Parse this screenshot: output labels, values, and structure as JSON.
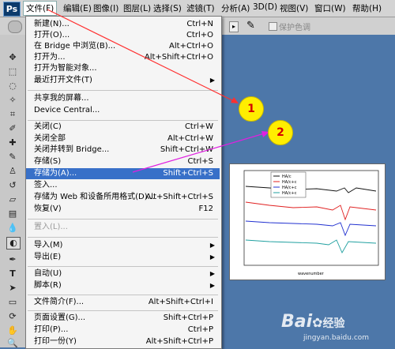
{
  "app_logo": "Ps",
  "menubar": [
    "文件(F)",
    "编辑(E)",
    "图像(I)",
    "图层(L)",
    "选择(S)",
    "滤镜(T)",
    "分析(A)",
    "3D(D)",
    "视图(V)",
    "窗口(W)",
    "帮助(H)"
  ],
  "options": {
    "protect_color": "保护色调"
  },
  "file_menu": [
    {
      "label": "新建(N)...",
      "shortcut": "Ctrl+N"
    },
    {
      "label": "打开(O)...",
      "shortcut": "Ctrl+O"
    },
    {
      "label": "在 Bridge 中浏览(B)...",
      "shortcut": "Alt+Ctrl+O"
    },
    {
      "label": "打开为...",
      "shortcut": "Alt+Shift+Ctrl+O"
    },
    {
      "label": "打开为智能对象...",
      "shortcut": ""
    },
    {
      "label": "最近打开文件(T)",
      "shortcut": ""
    },
    {
      "label": "共享我的屏幕...",
      "shortcut": ""
    },
    {
      "label": "Device Central...",
      "shortcut": ""
    },
    {
      "label": "关闭(C)",
      "shortcut": "Ctrl+W"
    },
    {
      "label": "关闭全部",
      "shortcut": "Alt+Ctrl+W"
    },
    {
      "label": "关闭并转到 Bridge...",
      "shortcut": "Shift+Ctrl+W"
    },
    {
      "label": "存储(S)",
      "shortcut": "Ctrl+S"
    },
    {
      "label": "存储为(A)...",
      "shortcut": "Shift+Ctrl+S"
    },
    {
      "label": "签入...",
      "shortcut": ""
    },
    {
      "label": "存储为 Web 和设备所用格式(D)...",
      "shortcut": "Alt+Shift+Ctrl+S"
    },
    {
      "label": "恢复(V)",
      "shortcut": "F12"
    },
    {
      "label": "置入(L)...",
      "shortcut": ""
    },
    {
      "label": "导入(M)",
      "shortcut": ""
    },
    {
      "label": "导出(E)",
      "shortcut": ""
    },
    {
      "label": "自动(U)",
      "shortcut": ""
    },
    {
      "label": "脚本(R)",
      "shortcut": ""
    },
    {
      "label": "文件简介(F)...",
      "shortcut": "Alt+Shift+Ctrl+I"
    },
    {
      "label": "页面设置(G)...",
      "shortcut": "Shift+Ctrl+P"
    },
    {
      "label": "打印(P)...",
      "shortcut": "Ctrl+P"
    },
    {
      "label": "打印一份(Y)",
      "shortcut": "Alt+Shift+Ctrl+P"
    }
  ],
  "callouts": [
    "1",
    "2"
  ],
  "doc_legend": [
    "HA/c",
    "HA/c+c",
    "HA/c+c",
    "HA/c+c"
  ],
  "doc_xlabel": "wavenumber",
  "watermark": {
    "brand": "Bai",
    "brand2": "经验",
    "url": "jingyan.baidu.com"
  },
  "colors": {
    "menu_highlight": "#3870c8",
    "callout": "#ffee00",
    "arrow1": "#ff3030",
    "arrow2": "#e020e0"
  }
}
